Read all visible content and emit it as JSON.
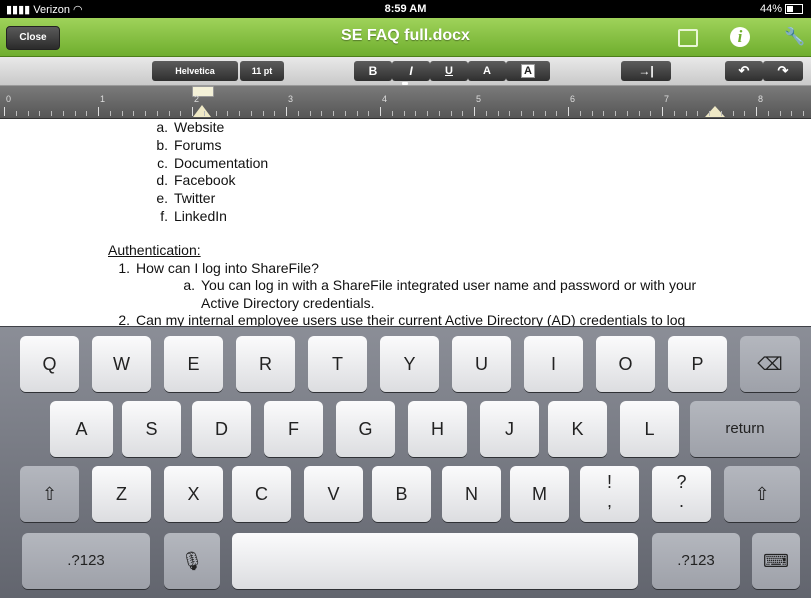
{
  "status_bar": {
    "carrier": "Verizon",
    "time": "8:59 AM",
    "battery": "44%"
  },
  "title_bar": {
    "close_label": "Close",
    "title": "SE FAQ full.docx",
    "icons": [
      "image-icon",
      "info-icon",
      "wrench-icon"
    ]
  },
  "format_toolbar": {
    "font": "Helvetica",
    "size": "11 pt",
    "bold": "B",
    "italic": "I",
    "underline": "U",
    "text_color": "A",
    "highlight": "A",
    "indent": "→|",
    "undo": "↶",
    "redo": "↷"
  },
  "ruler": {
    "numbers": [
      "0",
      "1",
      "2",
      "3",
      "4",
      "5",
      "6",
      "7",
      "8"
    ]
  },
  "document": {
    "list_items": [
      {
        "marker": "a.",
        "text": "Website"
      },
      {
        "marker": "b.",
        "text": "Forums"
      },
      {
        "marker": "c.",
        "text": "Documentation"
      },
      {
        "marker": "d.",
        "text": "Facebook"
      },
      {
        "marker": "e.",
        "text": "Twitter"
      },
      {
        "marker": "f.",
        "text": "LinkedIn"
      }
    ],
    "heading": "Authentication:",
    "q1_marker": "1.",
    "q1": "How can I log into ShareFile?",
    "a1_marker": "a.",
    "a1_line1": "You can log in with a ShareFile integrated user name and password or with your",
    "a1_line2": "Active Directory credentials.",
    "q2_marker": "2.",
    "q2": "Can my internal employee users use their current Active Directory (AD) credentials to log"
  },
  "keyboard": {
    "row1": [
      "Q",
      "W",
      "E",
      "R",
      "T",
      "Y",
      "U",
      "I",
      "O",
      "P"
    ],
    "backspace": "⌫",
    "row2": [
      "A",
      "S",
      "D",
      "F",
      "G",
      "H",
      "J",
      "K",
      "L"
    ],
    "return": "return",
    "shift": "⇧",
    "row3": [
      "Z",
      "X",
      "C",
      "V",
      "B",
      "N",
      "M"
    ],
    "excl_top": "!",
    "excl_bottom": ",",
    "q_top": "?",
    "q_bottom": ".",
    "numbers": ".?123",
    "mic": "🎙",
    "hide_keyboard": "⌨"
  }
}
